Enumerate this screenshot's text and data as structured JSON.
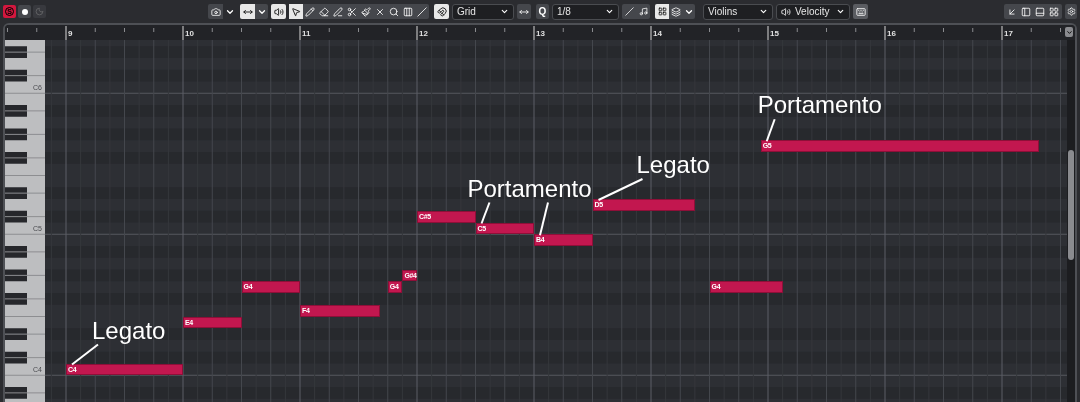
{
  "left_buttons": [
    {
      "kind": "solo",
      "label": "S",
      "on": true
    },
    {
      "kind": "listen",
      "on": false
    },
    {
      "kind": "edit_in_place",
      "disabled": true
    }
  ],
  "tools": [
    {
      "kind": "select",
      "selected": true
    },
    {
      "kind": "draw",
      "selected": false
    },
    {
      "kind": "erase",
      "selected": false
    },
    {
      "kind": "trim",
      "selected": false
    },
    {
      "kind": "split",
      "selected": false
    },
    {
      "kind": "glue",
      "selected": false
    },
    {
      "kind": "mute",
      "selected": false
    },
    {
      "kind": "zoom",
      "selected": false
    },
    {
      "kind": "comb",
      "selected": false
    },
    {
      "kind": "line",
      "selected": false
    }
  ],
  "snap": {
    "on": true,
    "type": "Grid"
  },
  "quantize": {
    "label": "Q",
    "value": "1/8"
  },
  "color_toggle": {
    "on": true
  },
  "track": "Violins",
  "controller": "Velocity",
  "ruler": {
    "bars": [
      "9",
      "10",
      "11",
      "12",
      "13",
      "14",
      "15",
      "16",
      "17"
    ]
  },
  "keyboard": {
    "labels": [
      "C6",
      "C5",
      "C4"
    ]
  },
  "notes": [
    {
      "label": "C4"
    },
    {
      "label": "E4"
    },
    {
      "label": "G4"
    },
    {
      "label": "F4"
    },
    {
      "label": "G4"
    },
    {
      "label": "G#4"
    },
    {
      "label": "C#5"
    },
    {
      "label": "C5"
    },
    {
      "label": "B4"
    },
    {
      "label": "D5"
    },
    {
      "label": "G4"
    },
    {
      "label": "G5"
    }
  ],
  "annotations": [
    {
      "text": "Legato"
    },
    {
      "text": "Portamento"
    },
    {
      "text": "Legato"
    },
    {
      "text": "Portamento"
    }
  ]
}
